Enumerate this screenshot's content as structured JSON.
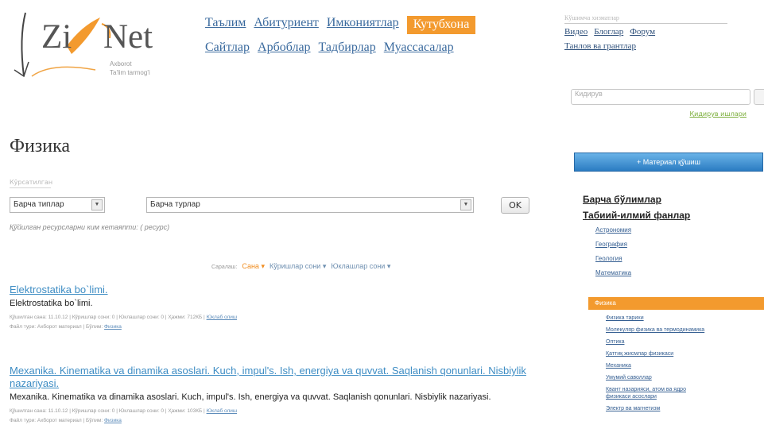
{
  "logo": {
    "word_left": "Zi",
    "word_right": "Net",
    "sub1": "Axborot",
    "sub2": "Ta'lim tarmog'i"
  },
  "nav": {
    "row1": [
      "Таълим",
      "Абитуриент",
      "Имкониятлар",
      "Кутубхона"
    ],
    "row2": [
      "Сайтлар",
      "Арбоблар",
      "Тадбирлар",
      "Муассасалар"
    ],
    "active": "Кутубхона"
  },
  "rightlinks": {
    "caption": "Кўшимча хизматлар",
    "row1": [
      "Видео",
      "Блоглар",
      "Форум"
    ],
    "row2": [
      "Танлов ва грантлар"
    ]
  },
  "search": {
    "placeholder": "Кидирув",
    "link": "Қидирув ишлари"
  },
  "page_title": "Физика",
  "filter": {
    "caption": "Кўрсатилган",
    "type_value": "Барча типлар",
    "sort_value": "Барча турлар",
    "ok_label": "OK"
  },
  "count_note": "Қўйилган ресурсларни ким кетаяпти: ( ресурс)",
  "sortbar": {
    "label": "Саралаш:",
    "items": [
      "Сана ▾",
      "Кўришлар сони ▾",
      "Юклашлар сони ▾"
    ]
  },
  "items": [
    {
      "title": "Elektrostatika bo`limi.",
      "desc": "Elektrostatika bo`limi.",
      "meta1": "Қўшилган сана: 11.10.12 | Кўришлар сони: 0 | Юклашлар сони: 0 | Ҳажми: 712КБ |",
      "meta1_link": "Юклаб олиш",
      "meta2": "Файл тури: Ахборот материал | Бўлим:",
      "meta2_link": "Физика"
    },
    {
      "title": "Mexanika. Kinematika va dinamika asoslari. Kuch, impul's. Ish, energiya va quvvat. Saqlanish qonunlari. Nisbiylik nazariyasi.",
      "desc": "Mexanika. Kinematika va dinamika asoslari. Kuch, impul's. Ish, energiya va quvvat. Saqlanish qonunlari. Nisbiylik nazariyasi.",
      "meta1": "Қўшилган сана: 11.10.12 | Кўришлар сони: 0 | Юклашлар сони: 0 | Ҳажми: 103КБ |",
      "meta1_link": "Юклаб олиш",
      "meta2": "Файл тури: Ахборот материал | Бўлим:",
      "meta2_link": "Физика"
    }
  ],
  "sidebar": {
    "add_button": "+ Материал қўшиш",
    "all_sections": "Барча бўлимлар",
    "natural_sciences": "Табиий-илмий фанлар",
    "subjects": [
      "Астрономия",
      "География",
      "Геология",
      "Математика"
    ],
    "active_subject": "Физика",
    "physics_subtopics": [
      "Физика тарихи",
      "Молекуляр физика ва термодинамика",
      "Оптика",
      "Қаттиқ жисмлар физикаси",
      "Механика",
      "Умумий саволлар",
      "Квант назарияси, атом ва ядро",
      "физикаси асослари",
      "Электр ва магнетизм"
    ]
  },
  "colors": {
    "accent_orange": "#f39a2e",
    "link_blue": "#3e8dc4",
    "nav_blue": "#3a6a9e"
  }
}
